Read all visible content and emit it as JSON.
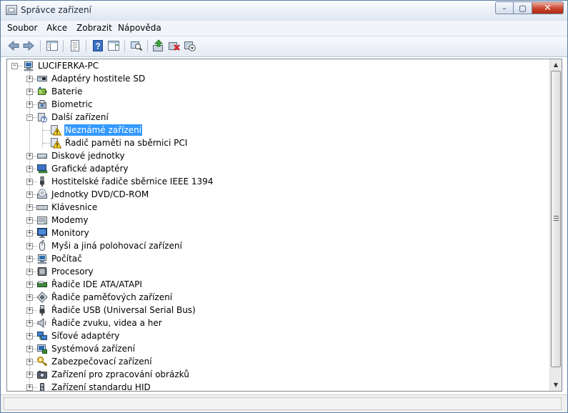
{
  "window": {
    "title": "Správce zařízení",
    "min_glyph": "–",
    "max_glyph": "▢",
    "close_glyph": "✕"
  },
  "menu": [
    {
      "label": "Soubor"
    },
    {
      "label": "Akce"
    },
    {
      "label": "Zobrazit"
    },
    {
      "label": "Nápověda"
    }
  ],
  "toolbar": [
    {
      "name": "back-button",
      "icon": "arrow-left-icon"
    },
    {
      "name": "forward-button",
      "icon": "arrow-right-icon"
    },
    {
      "name": "show-hide-console-tree-button",
      "icon": "console-tree-icon"
    },
    {
      "name": "properties-button",
      "icon": "properties-icon"
    },
    {
      "name": "help-button",
      "icon": "help-icon"
    },
    {
      "name": "show-action-pane-button",
      "icon": "action-pane-icon"
    },
    {
      "name": "scan-hardware-button",
      "icon": "scan-hardware-icon"
    },
    {
      "name": "update-driver-button",
      "icon": "update-driver-icon"
    },
    {
      "name": "uninstall-button",
      "icon": "uninstall-icon"
    },
    {
      "name": "disable-button",
      "icon": "disable-icon"
    }
  ],
  "tree": {
    "root": {
      "label": "LUCIFERKA-PC",
      "icon": "computer-icon"
    },
    "nodes": [
      {
        "label": "Adaptéry hostitele SD",
        "icon": "sd-host-icon",
        "expander": "+"
      },
      {
        "label": "Baterie",
        "icon": "battery-icon",
        "expander": "+"
      },
      {
        "label": "Biometric",
        "icon": "biometric-icon",
        "expander": "+"
      },
      {
        "label": "Další zařízení",
        "icon": "other-devices-icon",
        "expander": "−"
      },
      {
        "label": "Neznámé zařízení",
        "icon": "warning-device-icon",
        "child": true,
        "selected": true
      },
      {
        "label": "Řadič paměti na sběrnici PCI",
        "icon": "warning-device-icon",
        "child": true
      },
      {
        "label": "Diskové jednotky",
        "icon": "disk-drive-icon",
        "expander": "+"
      },
      {
        "label": "Grafické adaptéry",
        "icon": "display-adapter-icon",
        "expander": "+"
      },
      {
        "label": "Hostitelské řadiče sběrnice IEEE 1394",
        "icon": "ieee1394-icon",
        "expander": "+"
      },
      {
        "label": "Jednotky DVD/CD-ROM",
        "icon": "dvd-drive-icon",
        "expander": "+"
      },
      {
        "label": "Klávesnice",
        "icon": "keyboard-icon",
        "expander": "+"
      },
      {
        "label": "Modemy",
        "icon": "modem-icon",
        "expander": "+"
      },
      {
        "label": "Monitory",
        "icon": "monitor-icon",
        "expander": "+"
      },
      {
        "label": "Myši a jiná polohovací zařízení",
        "icon": "mouse-icon",
        "expander": "+"
      },
      {
        "label": "Počítač",
        "icon": "computer-icon",
        "expander": "+"
      },
      {
        "label": "Procesory",
        "icon": "processor-icon",
        "expander": "+"
      },
      {
        "label": "Řadiče IDE ATA/ATAPI",
        "icon": "ide-controller-icon",
        "expander": "+"
      },
      {
        "label": "Řadiče paměťových zařízení",
        "icon": "storage-controller-icon",
        "expander": "+"
      },
      {
        "label": "Řadiče USB (Universal Serial Bus)",
        "icon": "usb-icon",
        "expander": "+"
      },
      {
        "label": "Řadiče zvuku, videa a her",
        "icon": "speaker-icon",
        "expander": "+"
      },
      {
        "label": "Síťové adaptéry",
        "icon": "network-adapter-icon",
        "expander": "+"
      },
      {
        "label": "Systémová zařízení",
        "icon": "system-device-icon",
        "expander": "+"
      },
      {
        "label": "Zabezpečovací zařízení",
        "icon": "security-device-icon",
        "expander": "+"
      },
      {
        "label": "Zařízení pro zpracování obrázků",
        "icon": "imaging-device-icon",
        "expander": "+"
      },
      {
        "label": "Zařízení standardu HID",
        "icon": "hid-icon",
        "expander": "+"
      }
    ]
  },
  "scrollbar": {
    "up_glyph": "▲",
    "down_glyph": "▼",
    "thumb_fraction": 0.96
  },
  "statusbar": {
    "text": ""
  }
}
